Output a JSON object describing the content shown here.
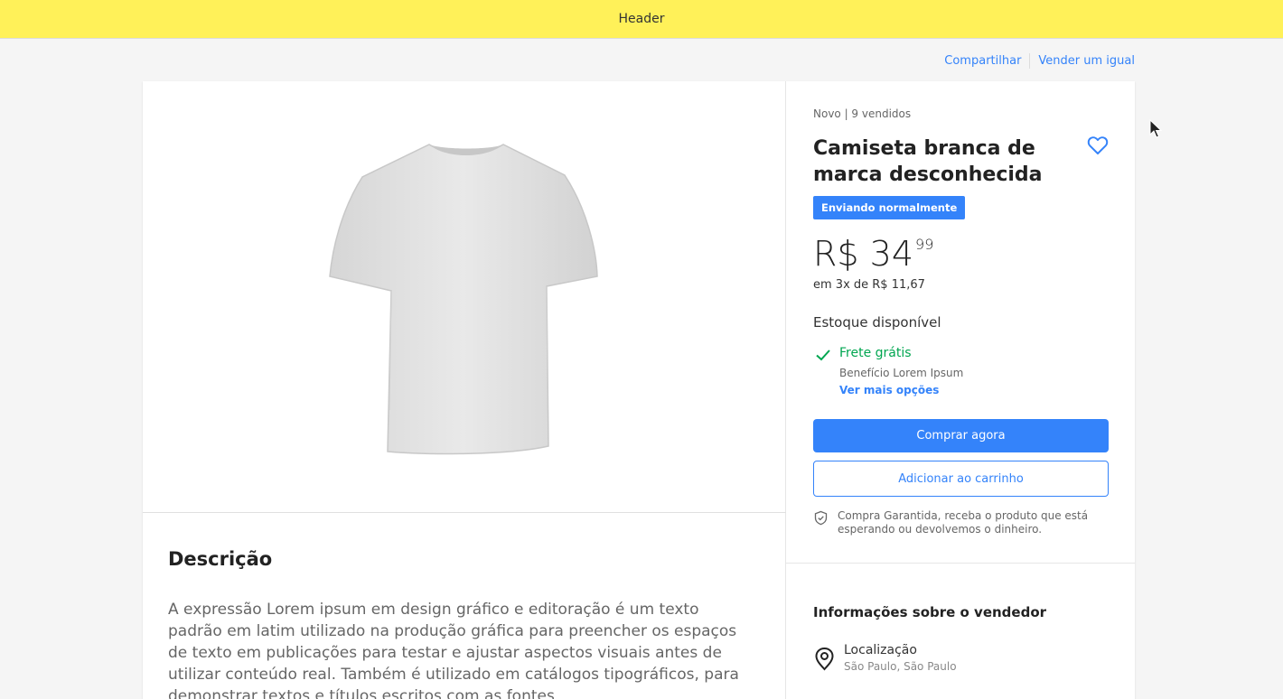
{
  "header": {
    "title": "Header"
  },
  "top_links": {
    "share": "Compartilhar",
    "sell": "Vender um igual"
  },
  "product": {
    "subtitle": "Novo | 9 vendidos",
    "title": "Camiseta branca de marca desconhecida",
    "badge": "Enviando normalmente",
    "price_main": "R$ 34",
    "price_cents": "99",
    "installments": "em 3x de R$ 11,67",
    "stock": "Estoque disponível",
    "shipping": {
      "title": "Frete grátis",
      "subtitle": "Benefício Lorem Ipsum",
      "more": "Ver mais opções"
    },
    "buy_button": "Comprar agora",
    "cart_button": "Adicionar ao carrinho",
    "guarantee": "Compra Garantida, receba o produto que está esperando ou devolvemos o dinheiro."
  },
  "description": {
    "title": "Descrição",
    "text": "A expressão Lorem ipsum em design gráfico e editoração é um texto padrão em latim utilizado na produção gráfica para preencher os espaços de texto em publicações para testar e ajustar aspectos visuais antes de utilizar conteúdo real. Também é utilizado em catálogos tipográficos, para demonstrar textos e títulos escritos com as fontes"
  },
  "seller": {
    "title": "Informações sobre o vendedor",
    "location_label": "Localização",
    "location_value": "São Paulo, São Paulo"
  },
  "icons": {
    "favorite": "heart-outline-icon",
    "shipping": "check-icon",
    "guarantee": "shield-check-icon",
    "location": "location-pin-icon"
  },
  "colors": {
    "header": "#fff159",
    "accent": "#3483fa",
    "success": "#00a650"
  }
}
